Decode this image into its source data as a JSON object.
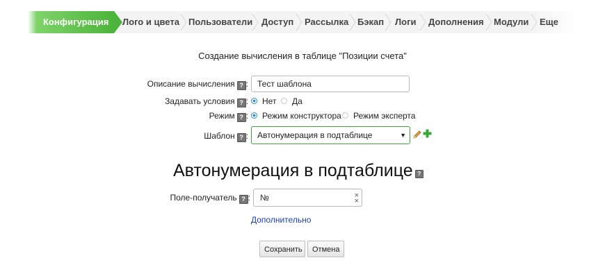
{
  "tabs": {
    "config": "Конфигурация",
    "logo": "Лого и цвета",
    "users": "Пользователи",
    "access": "Доступ",
    "mailing": "Рассылка",
    "backup": "Бэкап",
    "logs": "Логи",
    "addons": "Дополнения",
    "modules": "Модули",
    "more": "Еще"
  },
  "form": {
    "heading": "Создание вычисления в таблице \"Позиции счета\"",
    "help_mark": "?",
    "description_label": "Описание вычисления",
    "description_value": "Тест шаблона",
    "conditions_label": "Задавать условия",
    "conditions_no": "Нет",
    "conditions_yes": "Да",
    "mode_label": "Режим",
    "mode_constructor": "Режим конструктора",
    "mode_expert": "Режим эксперта",
    "template_label": "Шаблон",
    "template_value": "Автонумерация в подтаблице"
  },
  "section": {
    "title": "Автонумерация в подтаблице",
    "target_field_label": "Поле-получатель",
    "target_field_value": "№",
    "more_link": "Дополнительно"
  },
  "actions": {
    "save": "Сохранить",
    "cancel": "Отмена"
  },
  "colors": {
    "active_tab": "#4cb43a",
    "link": "#1a3fb8",
    "radio": "#2a8ad6"
  }
}
